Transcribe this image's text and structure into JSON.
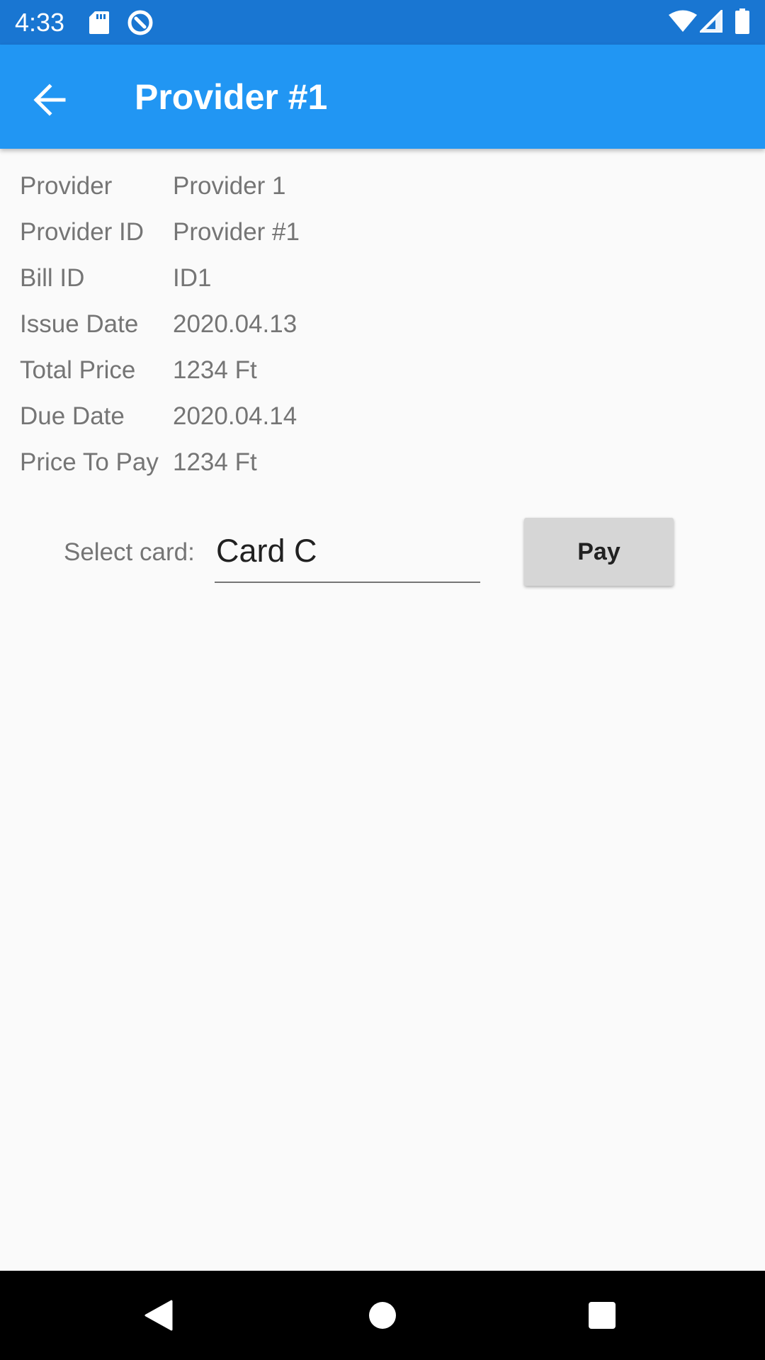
{
  "status_bar": {
    "time": "4:33",
    "icons": [
      "sd-card-icon",
      "data-saver-icon",
      "wifi-icon",
      "cell-signal-icon",
      "battery-icon"
    ]
  },
  "app_bar": {
    "title": "Provider #1",
    "color": "#2196f3",
    "back_icon": "arrow-back-icon"
  },
  "details": [
    {
      "label": "Provider",
      "value": "Provider 1"
    },
    {
      "label": "Provider ID",
      "value": "Provider #1"
    },
    {
      "label": "Bill ID",
      "value": "ID1"
    },
    {
      "label": "Issue Date",
      "value": "2020.04.13"
    },
    {
      "label": "Total Price",
      "value": "1234 Ft"
    },
    {
      "label": "Due Date",
      "value": "2020.04.14"
    },
    {
      "label": "Price To Pay",
      "value": "1234 Ft"
    }
  ],
  "payment": {
    "select_label": "Select card:",
    "selected_card": "Card C",
    "pay_label": "Pay"
  },
  "nav_bar": {
    "icons": [
      "back-triangle-icon",
      "home-circle-icon",
      "recents-square-icon"
    ]
  }
}
